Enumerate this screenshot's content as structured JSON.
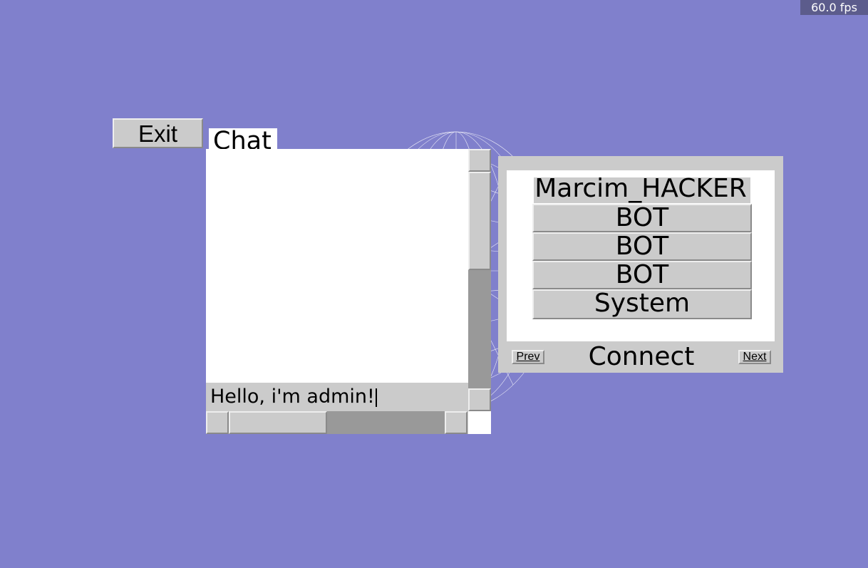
{
  "hud": {
    "fps": "60.0 fps"
  },
  "menu": {
    "exit_label": "Exit"
  },
  "chat": {
    "tab_label": "Chat",
    "input_value": "Hello, i'm admin!",
    "vertical_scroll_fraction": 0.45,
    "horizontal_scroll_fraction": 0.5
  },
  "users": {
    "items": [
      {
        "label": "Marcim_HACKER"
      },
      {
        "label": "BOT"
      },
      {
        "label": "BOT"
      },
      {
        "label": "BOT"
      },
      {
        "label": "System"
      }
    ],
    "prev_label": "Prev",
    "next_label": "Next",
    "connect_label": "Connect"
  },
  "colors": {
    "background": "#8080cc",
    "widget": "#cbcbcb",
    "scroll_thumb": "#999999",
    "fps_badge": "#5c5c8c"
  }
}
